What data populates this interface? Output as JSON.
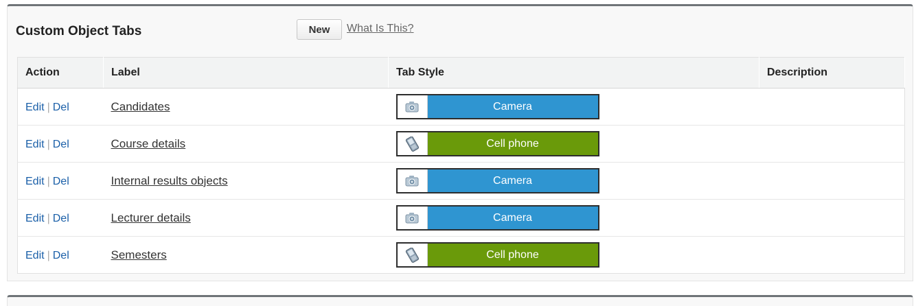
{
  "panel": {
    "title": "Custom Object Tabs",
    "new_button_label": "New",
    "help_link_label": "What Is This?"
  },
  "table": {
    "headers": {
      "action": "Action",
      "label": "Label",
      "tab_style": "Tab Style",
      "description": "Description"
    },
    "rows": [
      {
        "edit": "Edit",
        "separator": "|",
        "del": "Del",
        "label": "Candidates",
        "tab_style": "Camera",
        "icon": "camera-icon",
        "color": "#2f95d1",
        "description": ""
      },
      {
        "edit": "Edit",
        "separator": "|",
        "del": "Del",
        "label": "Course details",
        "tab_style": "Cell phone",
        "icon": "cell-phone-icon",
        "color": "#6a9a0a",
        "description": ""
      },
      {
        "edit": "Edit",
        "separator": "|",
        "del": "Del",
        "label": "Internal results objects",
        "tab_style": "Camera",
        "icon": "camera-icon",
        "color": "#2f95d1",
        "description": ""
      },
      {
        "edit": "Edit",
        "separator": "|",
        "del": "Del",
        "label": "Lecturer details",
        "tab_style": "Camera",
        "icon": "camera-icon",
        "color": "#2f95d1",
        "description": ""
      },
      {
        "edit": "Edit",
        "separator": "|",
        "del": "Del",
        "label": "Semesters",
        "tab_style": "Cell phone",
        "icon": "cell-phone-icon",
        "color": "#6a9a0a",
        "description": ""
      }
    ]
  },
  "colors": {
    "link": "#1a5fa8",
    "header_border": "#6f7478",
    "camera": "#2f95d1",
    "cell_phone": "#6a9a0a"
  }
}
